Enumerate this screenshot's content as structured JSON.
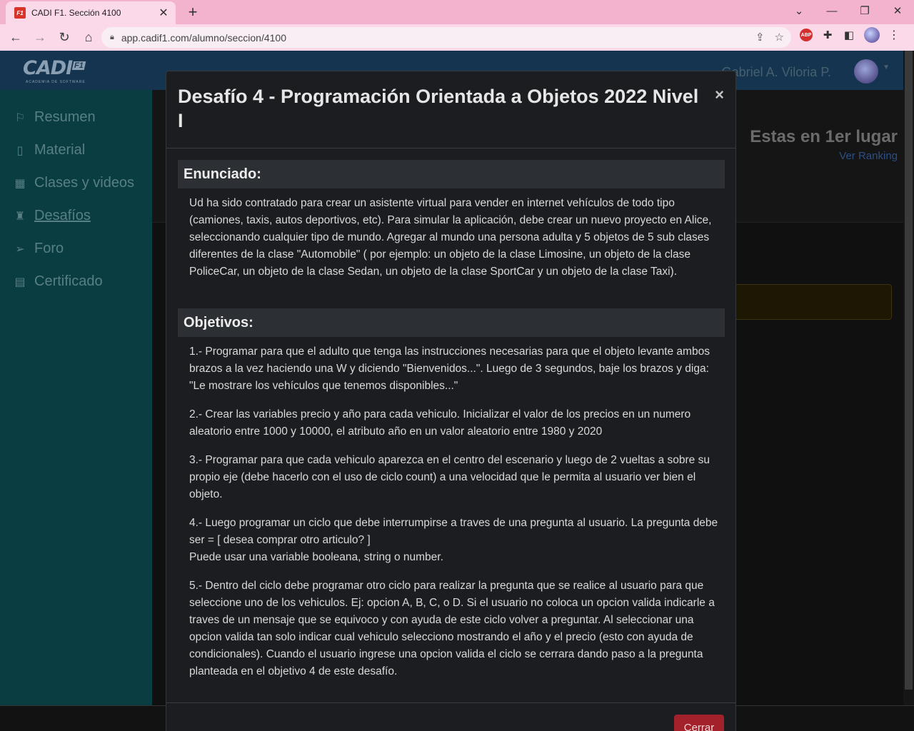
{
  "browser": {
    "tab_title": "CADI F1. Sección 4100",
    "tab_favicon_text": "F1",
    "url": "app.cadif1.com/alumno/seccion/4100"
  },
  "app": {
    "logo_text": "CADI",
    "logo_badge": "F1",
    "logo_subtitle": "ACADEMIA DE SOFTWARE",
    "user_name": "Gabriel A. Viloria P.",
    "sidebar": [
      {
        "label": "Resumen",
        "icon": "flag-icon"
      },
      {
        "label": "Material",
        "icon": "book-icon"
      },
      {
        "label": "Clases y videos",
        "icon": "calendar-icon"
      },
      {
        "label": "Desafíos",
        "icon": "trophy-icon",
        "active": true
      },
      {
        "label": "Foro",
        "icon": "send-icon"
      },
      {
        "label": "Certificado",
        "icon": "certificate-icon"
      }
    ],
    "rank_text": "Estas en 1er lugar",
    "rank_link": "Ver Ranking"
  },
  "modal": {
    "title": "Desafío 4 - Programación Orientada a Objetos 2022 Nivel I",
    "close_symbol": "×",
    "enunciado_heading": "Enunciado:",
    "enunciado_text": "Ud ha sido contratado para crear un asistente virtual para vender en internet vehículos de todo tipo (camiones, taxis, autos deportivos, etc). Para simular la aplicación, debe crear un nuevo proyecto en Alice, seleccionando cualquier tipo de mundo. Agregar al mundo una persona adulta y 5 objetos de 5 sub clases diferentes de la clase \"Automobile\" ( por ejemplo: un objeto de la clase Limosine, un objeto de la clase PoliceCar, un objeto de la clase Sedan, un objeto de la clase SportCar y un objeto de la clase Taxi).",
    "objetivos_heading": "Objetivos:",
    "objetivos": [
      "1.- Programar para que el adulto que tenga las instrucciones necesarias para que el objeto levante ambos brazos a la vez haciendo una W y diciendo \"Bienvenidos...\". Luego de 3 segundos, baje los brazos y diga: \"Le mostrare los vehículos que tenemos disponibles...\"",
      "2.- Crear las variables precio y año para cada vehiculo. Inicializar el valor de los precios en un numero aleatorio entre 1000 y 10000, el atributo año en un valor aleatorio entre 1980 y 2020",
      "3.- Programar para que cada vehiculo aparezca en el centro del escenario y luego de 2 vueltas a sobre su propio eje (debe hacerlo con el uso de ciclo count) a una velocidad que le permita al usuario ver bien el objeto.",
      "4.- Luego programar un ciclo que debe interrumpirse a traves de una pregunta al usuario. La pregunta debe ser = [ desea comprar otro articulo? ]",
      "Puede usar una variable booleana, string o number.",
      "5.- Dentro del ciclo debe programar otro ciclo para realizar la pregunta que se realice al usuario para que seleccione uno de los vehiculos. Ej: opcion A, B, C, o D. Si el usuario no coloca un opcion valida indicarle a traves de un mensaje que se equivoco y con ayuda de este ciclo volver a preguntar. Al seleccionar una opcion valida tan solo indicar cual vehiculo selecciono mostrando el año y el precio (esto con ayuda de condicionales). Cuando el usuario ingrese una opcion valida el ciclo se cerrara dando paso a la pregunta planteada en el objetivo 4 de este desafío."
    ],
    "close_button": "Cerrar"
  },
  "colors": {
    "header": "#14344f",
    "sidebar": "#0a3d42",
    "modal_bg": "#1b1d20",
    "close_button": "#a3212a",
    "link": "#2b4f86"
  }
}
